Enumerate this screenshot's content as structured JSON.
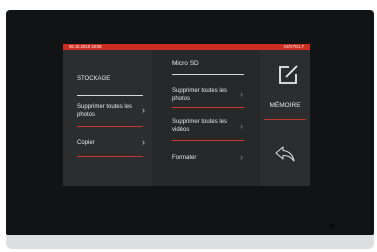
{
  "status": {
    "datetime": "06.10.2018 19:08",
    "version": "V2/V7G1.7"
  },
  "left_menu": {
    "header": "STOCKAGE",
    "items": [
      {
        "label": "Supprimer toutes les photos",
        "icon": "chevron-right-icon"
      },
      {
        "label": "Copier",
        "icon": "chevron-right-icon"
      }
    ]
  },
  "sub_menu": {
    "title": "Micro SD",
    "items": [
      {
        "label": "Supprimer toutes les photos",
        "icon": "chevron-right-icon"
      },
      {
        "label": "Supprimer toutes les vidéos",
        "icon": "chevron-right-icon"
      },
      {
        "label": "Formater",
        "icon": "chevron-right-icon"
      }
    ]
  },
  "right_panel": {
    "memory_label": "MÉMOIRE",
    "memory_icon": "edit-icon",
    "back_icon": "back-arrow-icon"
  },
  "colors": {
    "accent": "#cc2e1f",
    "screen_bg": "#2a2b2d",
    "bezel": "#121315"
  }
}
